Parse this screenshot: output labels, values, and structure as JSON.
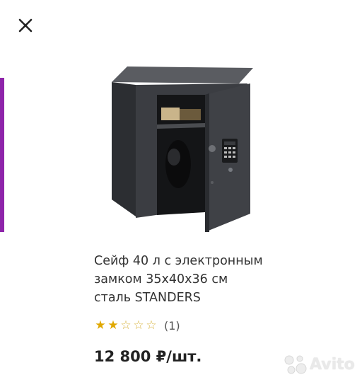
{
  "header": {
    "close_icon": "close-icon"
  },
  "product": {
    "title_line1": "Сейф 40 л с электронным",
    "title_line2": "замком 35x40x36 см",
    "title_line3": "сталь STANDERS",
    "rating": {
      "stars_filled": 2,
      "stars_total": 5,
      "review_count": "(1)"
    },
    "price": "12 800 ₽/шт."
  },
  "watermark": {
    "text": "Avito"
  },
  "colors": {
    "accent_bar": "#8e24aa",
    "star": "#e0a800",
    "text": "#333333"
  }
}
